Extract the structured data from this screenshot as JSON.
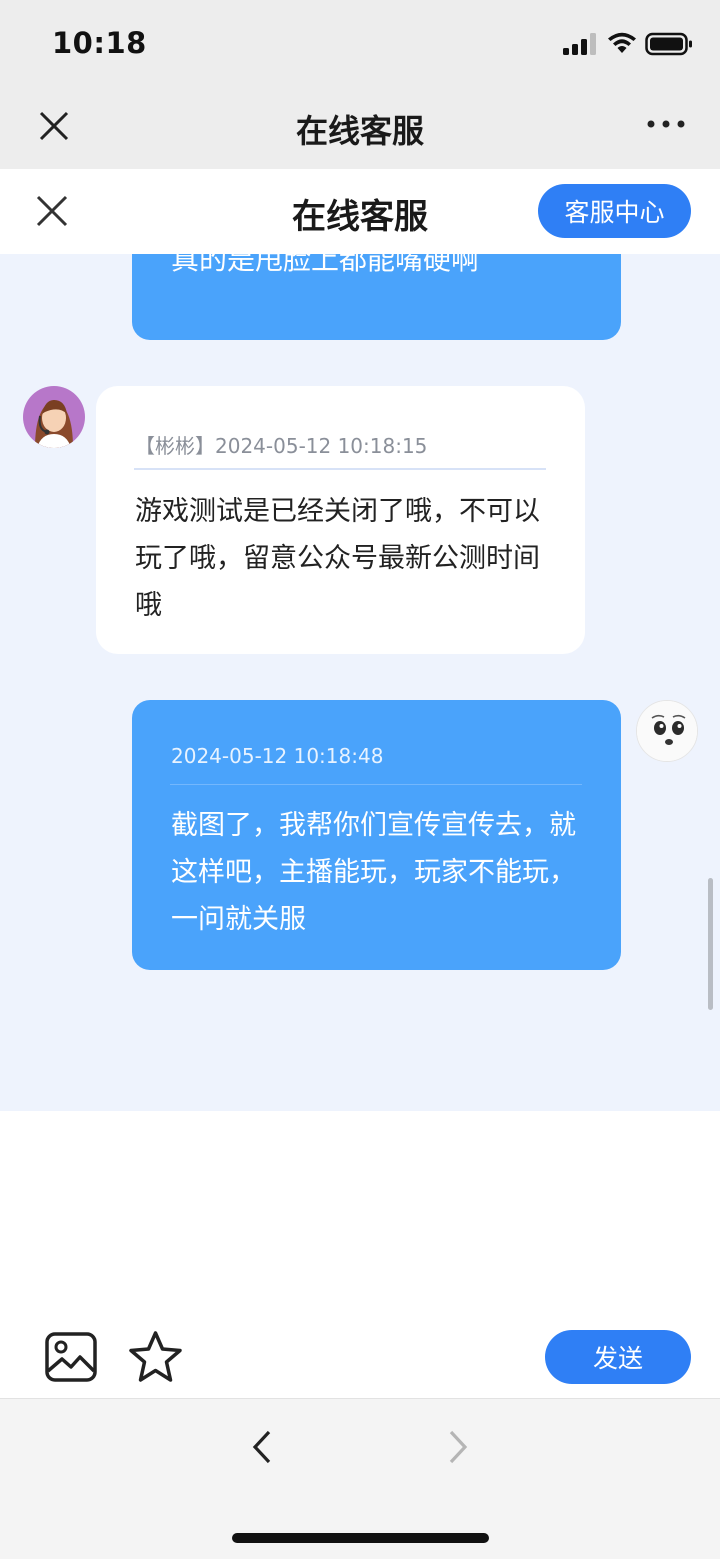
{
  "status_bar": {
    "time": "10:18",
    "icons": [
      "cellular-signal-icon",
      "wifi-icon",
      "battery-icon"
    ]
  },
  "browser_bar": {
    "title": "在线客服",
    "icons": [
      "close-icon",
      "more-icon"
    ]
  },
  "page_header": {
    "title": "在线客服",
    "center_button": "客服中心",
    "accent_color": "#2f7ff5"
  },
  "messages": [
    {
      "from": "user",
      "timestamp": "",
      "text": "真的是甩脸上都能嘴硬啊"
    },
    {
      "from": "agent",
      "meta": "【彬彬】2024-05-12 10:18:15",
      "text": "游戏测试是已经关闭了哦，不可以玩了哦，留意公众号最新公测时间哦"
    },
    {
      "from": "user",
      "meta": "2024-05-12 10:18:48",
      "text": "截图了，我帮你们宣传宣传去，就这样吧，主播能玩，玩家不能玩，一问就关服"
    }
  ],
  "colors": {
    "user_bubble": "#4aa3fb",
    "agent_bubble": "#ffffff",
    "chat_background": "#eef3fd"
  },
  "toolbar": {
    "send_label": "发送",
    "icons": [
      "image-icon",
      "star-icon"
    ]
  },
  "bottom_nav": {
    "icons": [
      "chevron-left-icon",
      "chevron-right-icon"
    ]
  }
}
